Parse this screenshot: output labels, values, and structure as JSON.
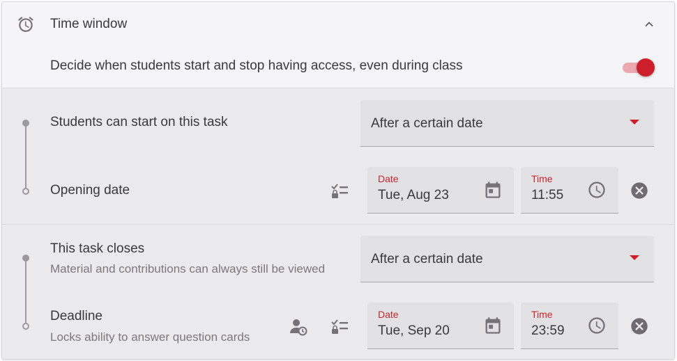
{
  "header": {
    "title": "Time window",
    "description": "Decide when students start and stop having access, even during class",
    "toggle_on": true,
    "icon": "alarm-clock-icon",
    "collapse_icon": "chevron-up-icon"
  },
  "start": {
    "label": "Students can start on this task",
    "select_value": "After a certain date",
    "opening_label": "Opening date",
    "date_label": "Date",
    "date_value": "Tue, Aug 23",
    "time_label": "Time",
    "time_value": "11:55"
  },
  "close": {
    "label": "This task closes",
    "sub": "Material and contributions can always still be viewed",
    "select_value": "After a certain date",
    "deadline_label": "Deadline",
    "deadline_sub": "Locks ability to answer question cards",
    "date_label": "Date",
    "date_value": "Tue, Sep 20",
    "time_label": "Time",
    "time_value": "23:59"
  },
  "colors": {
    "accent": "#cc1f2b",
    "toggle_track": "#ecaab0",
    "field_bg": "#e2e1e3",
    "section_bg": "#ebeaec"
  }
}
